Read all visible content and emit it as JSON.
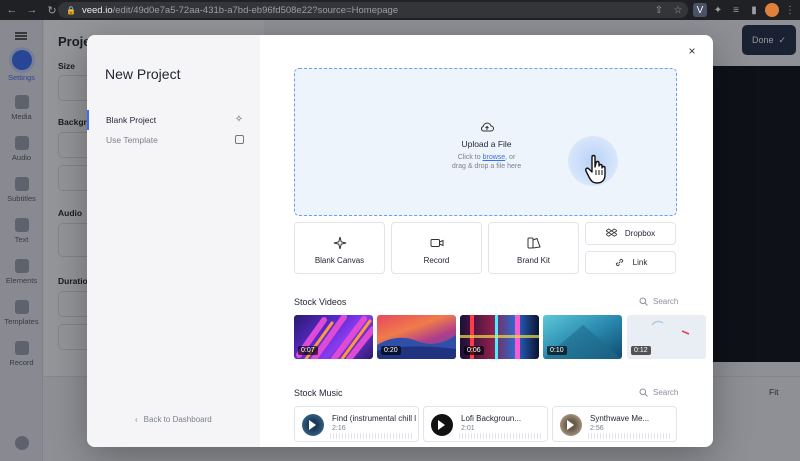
{
  "browser": {
    "url_host": "veed.io",
    "url_path": "/edit/49d0e7a5-72aa-431b-a7bd-eb96fd508e22?source=Homepage"
  },
  "app": {
    "nav": [
      {
        "label": "Settings",
        "icon": "gear-icon",
        "active": true
      },
      {
        "label": "Media",
        "icon": "plus-icon"
      },
      {
        "label": "Audio",
        "icon": "music-icon"
      },
      {
        "label": "Subtitles",
        "icon": "subtitles-icon"
      },
      {
        "label": "Text",
        "icon": "text-icon"
      },
      {
        "label": "Elements",
        "icon": "elements-icon"
      },
      {
        "label": "Templates",
        "icon": "templates-icon"
      },
      {
        "label": "Record",
        "icon": "record-icon"
      }
    ],
    "panel_title": "Project",
    "panel_labels": [
      "Size",
      "Backgro",
      "Audio",
      "Duration"
    ],
    "done_label": "Done",
    "fit_label": "Fit"
  },
  "modal": {
    "title": "New Project",
    "menu": [
      {
        "label": "Blank Project",
        "icon": "sparkle-icon"
      },
      {
        "label": "Use Template",
        "icon": "template-icon"
      }
    ],
    "back_label": "Back to Dashboard",
    "upload": {
      "title": "Upload a File",
      "line1_pre": "Click to ",
      "line1_link": "browse",
      "line1_post": ", or",
      "line2": "drag & drop a file here"
    },
    "options": [
      {
        "label": "Blank Canvas",
        "icon": "sparkle-icon"
      },
      {
        "label": "Record",
        "icon": "camera-icon"
      },
      {
        "label": "Brand Kit",
        "icon": "brand-kit-icon"
      }
    ],
    "side_options": [
      {
        "label": "Dropbox",
        "icon": "dropbox-icon"
      },
      {
        "label": "Link",
        "icon": "link-icon"
      }
    ],
    "stock_videos": {
      "title": "Stock Videos",
      "search": "Search",
      "items": [
        {
          "duration": "0:07"
        },
        {
          "duration": "0:20"
        },
        {
          "duration": "0:06"
        },
        {
          "duration": "0:10"
        },
        {
          "duration": "0:12"
        }
      ]
    },
    "stock_music": {
      "title": "Stock Music",
      "search": "Search",
      "items": [
        {
          "title": "Find (instrumental chill lo",
          "duration": "2:16"
        },
        {
          "title": "Lofi Backgroun...",
          "duration": "2:01"
        },
        {
          "title": "Synthwave Me...",
          "duration": "2:56"
        }
      ]
    }
  }
}
